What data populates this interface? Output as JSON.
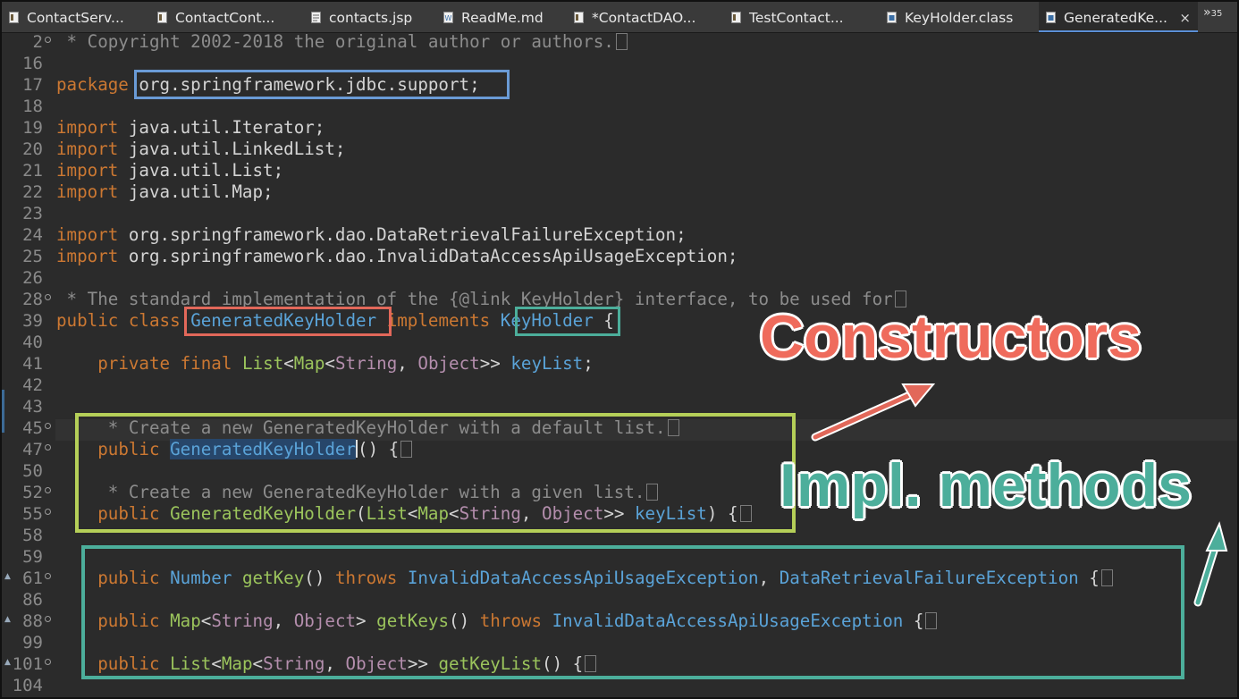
{
  "tabs": [
    {
      "label": "ContactServ...",
      "icon": "java-file-icon"
    },
    {
      "label": "ContactCont...",
      "icon": "java-file-icon"
    },
    {
      "label": "contacts.jsp",
      "icon": "jsp-file-icon"
    },
    {
      "label": "ReadMe.md",
      "icon": "markdown-file-icon"
    },
    {
      "label": "*ContactDAO...",
      "icon": "java-file-icon"
    },
    {
      "label": "TestContact...",
      "icon": "java-file-icon"
    },
    {
      "label": "KeyHolder.class",
      "icon": "class-file-icon"
    },
    {
      "label": "GeneratedKe...",
      "icon": "class-file-icon",
      "active": true,
      "close": "×"
    }
  ],
  "overflow": {
    "symbol": "»",
    "count": "35"
  },
  "lines": [
    {
      "n": "2",
      "t": " * Copyright 2002-2018 the original author or authors."
    },
    {
      "n": "16",
      "t": ""
    },
    {
      "n": "17",
      "t": "package org.springframework.jdbc.support;"
    },
    {
      "n": "18",
      "t": ""
    },
    {
      "n": "19",
      "t": "import java.util.Iterator;"
    },
    {
      "n": "20",
      "t": "import java.util.LinkedList;"
    },
    {
      "n": "21",
      "t": "import java.util.List;"
    },
    {
      "n": "22",
      "t": "import java.util.Map;"
    },
    {
      "n": "23",
      "t": ""
    },
    {
      "n": "24",
      "t": "import org.springframework.dao.DataRetrievalFailureException;"
    },
    {
      "n": "25",
      "t": "import org.springframework.dao.InvalidDataAccessApiUsageException;"
    },
    {
      "n": "26",
      "t": ""
    },
    {
      "n": "28",
      "t": " * The standard implementation of the {@link KeyHolder} interface, to be used for"
    },
    {
      "n": "39",
      "t": "public class GeneratedKeyHolder implements KeyHolder {"
    },
    {
      "n": "40",
      "t": ""
    },
    {
      "n": "41",
      "t": "    private final List<Map<String, Object>> keyList;"
    },
    {
      "n": "42",
      "t": ""
    },
    {
      "n": "43",
      "t": ""
    },
    {
      "n": "45",
      "t": "     * Create a new GeneratedKeyHolder with a default list."
    },
    {
      "n": "47",
      "t": "    public GeneratedKeyHolder() {"
    },
    {
      "n": "50",
      "t": ""
    },
    {
      "n": "52",
      "t": "     * Create a new GeneratedKeyHolder with a given list."
    },
    {
      "n": "55",
      "t": "    public GeneratedKeyHolder(List<Map<String, Object>> keyList) {"
    },
    {
      "n": "58",
      "t": ""
    },
    {
      "n": "59",
      "t": ""
    },
    {
      "n": "61",
      "t": "    public Number getKey() throws InvalidDataAccessApiUsageException, DataRetrievalFailureException {"
    },
    {
      "n": "86",
      "t": ""
    },
    {
      "n": "88",
      "t": "    public Map<String, Object> getKeys() throws InvalidDataAccessApiUsageException {"
    },
    {
      "n": "99",
      "t": ""
    },
    {
      "n": "101",
      "t": "    public List<Map<String, Object>> getKeyList() {"
    },
    {
      "n": "104",
      "t": ""
    }
  ],
  "annotations": {
    "constructors": "Constructors",
    "impl_methods": "Impl. methods"
  },
  "colors": {
    "package_box": "#6a9bd6",
    "class_box": "#e2685a",
    "interface_box": "#4cae9b",
    "constructors_box": "#b5cf58",
    "methods_box": "#4cae9b"
  }
}
